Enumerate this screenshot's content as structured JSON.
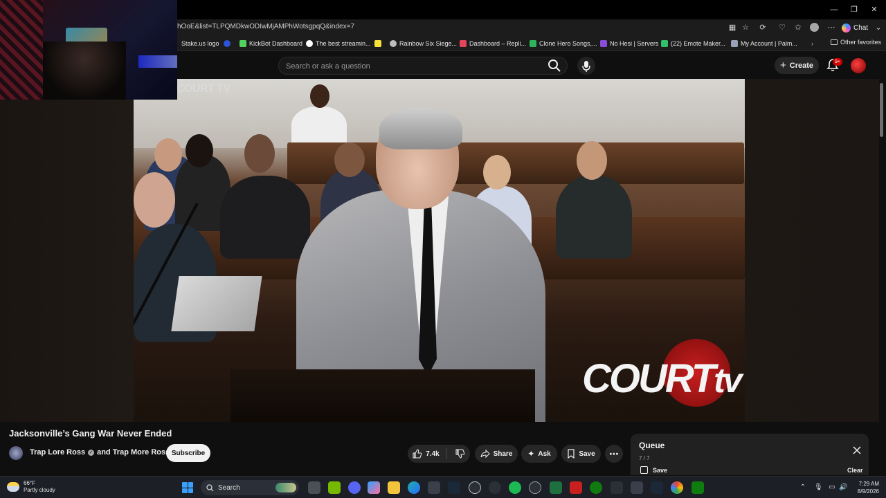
{
  "browser": {
    "url": "hOoE&list=TLPQMDkwODIwMjAMPhWotsgpqQ&index=7",
    "chat_label": "Chat",
    "window_controls": {
      "minimize": "—",
      "restore": "❐",
      "close": "✕"
    },
    "bookmarks": [
      {
        "label": "Stake.us logo",
        "color": "#2b6cff"
      },
      {
        "label": "",
        "color": "#2b55d6"
      },
      {
        "label": "KickBot Dashboard",
        "color": "#53d15e"
      },
      {
        "label": "The best streamin...",
        "color": "#ffffff"
      },
      {
        "label": "",
        "color": "#f7e23a"
      },
      {
        "label": "Rainbow Six Siege...",
        "color": "#bdbdbd"
      },
      {
        "label": "Dashboard – Repli...",
        "color": "#e3455a"
      },
      {
        "label": "Clone Hero Songs,...",
        "color": "#2fb35a"
      },
      {
        "label": "No Hesi | Servers",
        "color": "#8a4bd8"
      },
      {
        "label": "(22) Emote Maker...",
        "color": "#33c06a"
      },
      {
        "label": "My Account | Palm...",
        "color": "#9aa0b5"
      }
    ],
    "other_favorites": "Other favorites"
  },
  "youtube": {
    "search_placeholder": "Search or ask a question",
    "create_label": "Create",
    "notifications_badge": "9+"
  },
  "video": {
    "watermark_top": "COURT TV",
    "logo_text": "COURT",
    "logo_tv": "tv",
    "title": "Jacksonville’s Gang War Never Ended",
    "channel": "Trap Lore Ross",
    "channel_suffix": "and Trap More Ross",
    "subscribe": "Subscribe",
    "likes": "7.4k",
    "share": "Share",
    "ask": "Ask",
    "save": "Save"
  },
  "queue": {
    "title": "Queue",
    "count": "7 / 7",
    "save": "Save",
    "clear": "Clear"
  },
  "taskbar": {
    "temperature": "66°F",
    "condition": "Partly cloudy",
    "search": "Search",
    "time": "7:29 AM",
    "date": "8/9/2026"
  }
}
